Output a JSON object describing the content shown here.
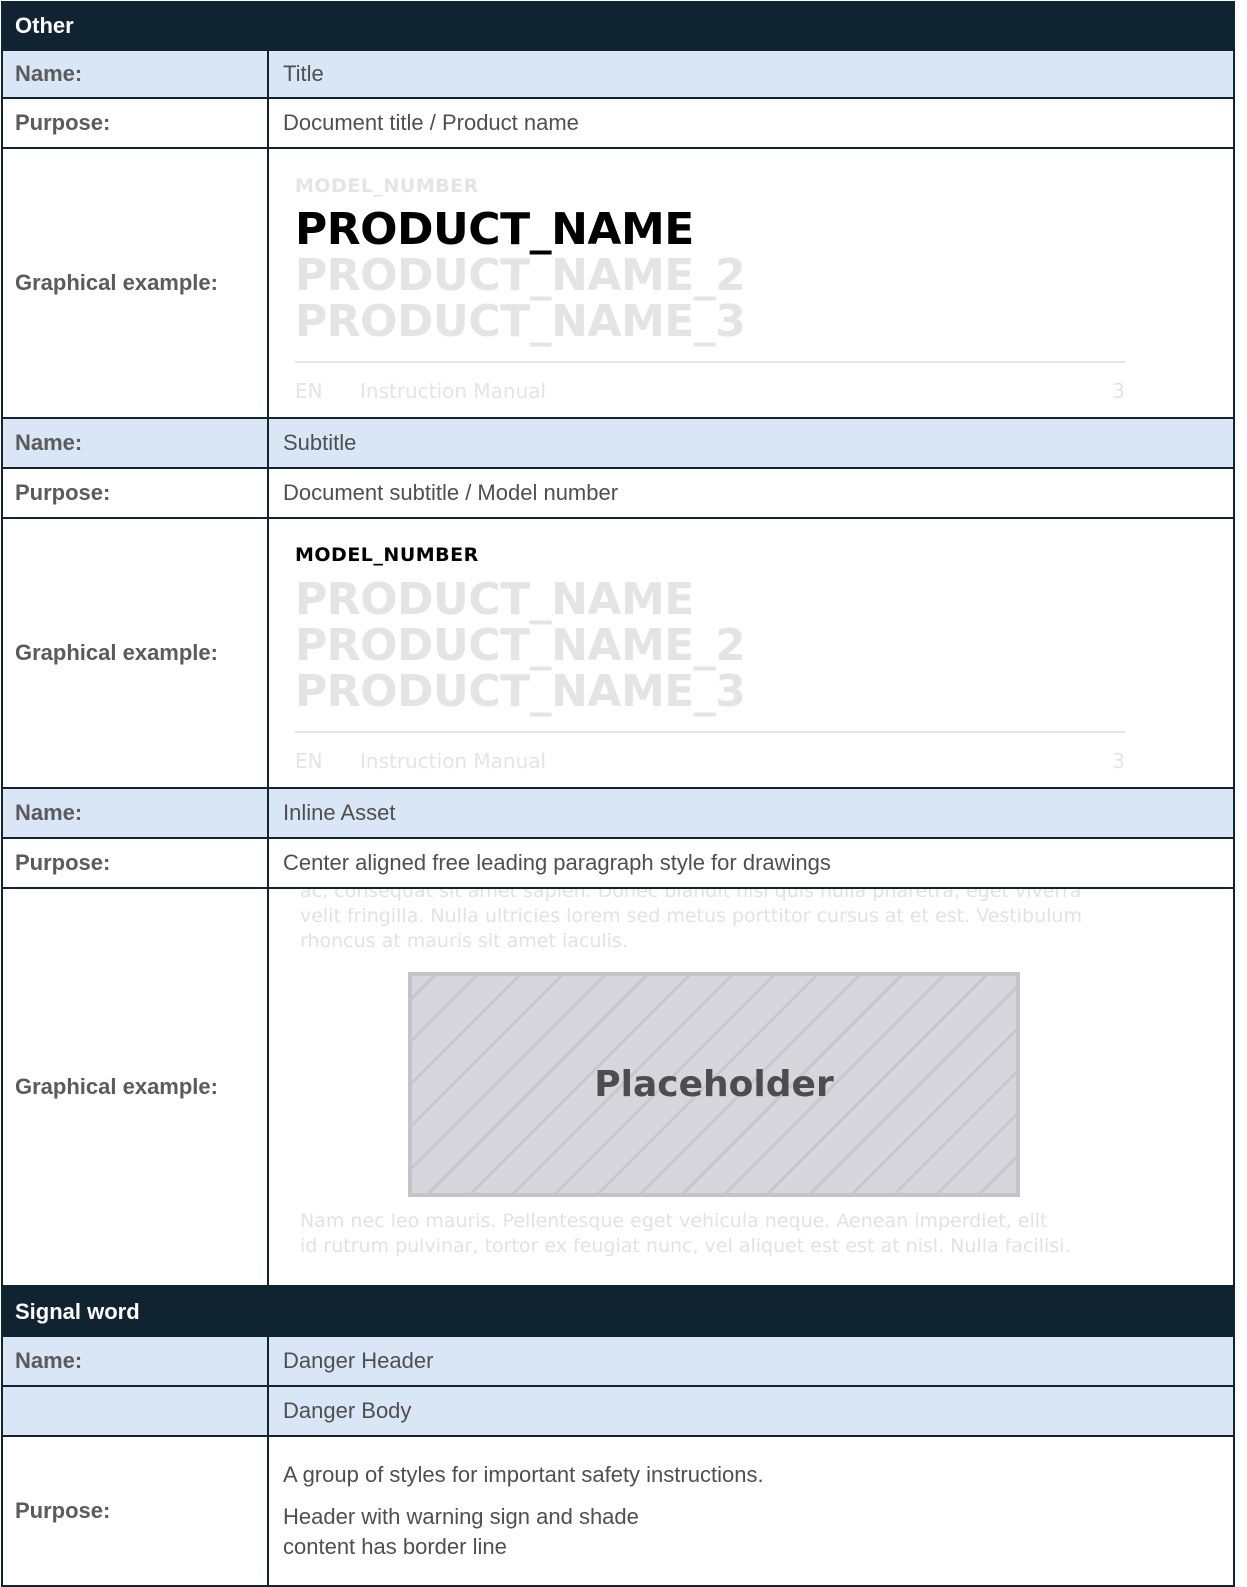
{
  "sections": {
    "other": {
      "header": "Other"
    },
    "signal_word": {
      "header": "Signal word"
    }
  },
  "labels": {
    "name": "Name:",
    "purpose": "Purpose:",
    "graphical_example": "Graphical example:"
  },
  "title_style": {
    "name": "Title",
    "purpose": "Document title / Product name",
    "example": {
      "model_number": "MODEL_NUMBER",
      "product_name": "PRODUCT_NAME",
      "product_name_2": "PRODUCT_NAME_2",
      "product_name_3": "PRODUCT_NAME_3",
      "footer_lang": "EN",
      "footer_manual": "Instruction Manual",
      "footer_page": "3"
    }
  },
  "subtitle_style": {
    "name": "Subtitle",
    "purpose": "Document subtitle / Model number",
    "example": {
      "model_number": "MODEL_NUMBER",
      "product_name": "PRODUCT_NAME",
      "product_name_2": "PRODUCT_NAME_2",
      "product_name_3": "PRODUCT_NAME_3",
      "footer_lang": "EN",
      "footer_manual": "Instruction Manual",
      "footer_page": "3"
    }
  },
  "inline_asset_style": {
    "name": "Inline Asset",
    "purpose": "Center aligned free leading paragraph style for drawings",
    "example": {
      "para_top_1": "ac, consequat sit amet sapien. Donec blandit nisl quis nulla pharetra, eget viverra",
      "para_top_2": "velit fringilla. Nulla ultricies lorem sed metus porttitor cursus at et est. Vestibulum",
      "para_top_3": "rhoncus at mauris sit amet iaculis.",
      "placeholder": "Placeholder",
      "para_bottom_1": "Nam nec leo mauris. Pellentesque eget vehicula neque. Aenean imperdiet, elit",
      "para_bottom_2": "id rutrum pulvinar, tortor ex feugiat nunc, vel aliquet est est at nisl. Nulla facilisi."
    }
  },
  "danger_style": {
    "name_1": "Danger Header",
    "name_2": "Danger Body",
    "purpose_1": "A group of styles for important safety instructions.",
    "purpose_2": "Header with warning sign and shade",
    "purpose_3": "content has border line"
  },
  "colors": {
    "header_bg": "#102331",
    "name_row_bg": "#d9e6f6",
    "border": "#102331"
  }
}
